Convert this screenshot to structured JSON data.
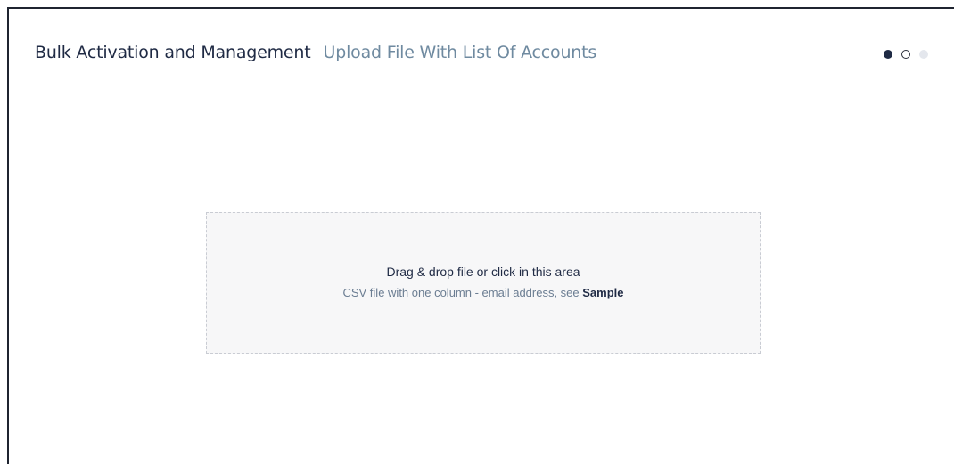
{
  "header": {
    "title": "Bulk Activation and Management",
    "subtitle": "Upload File With List Of Accounts"
  },
  "steps": {
    "total": 3,
    "current": 1,
    "colors": {
      "active": "#1f2a44",
      "inactive": "#e4e7ed"
    }
  },
  "dropzone": {
    "main_text": "Drag & drop file or click in this area",
    "sub_text": "CSV file with one column - email address, see",
    "sample_link": "Sample"
  }
}
